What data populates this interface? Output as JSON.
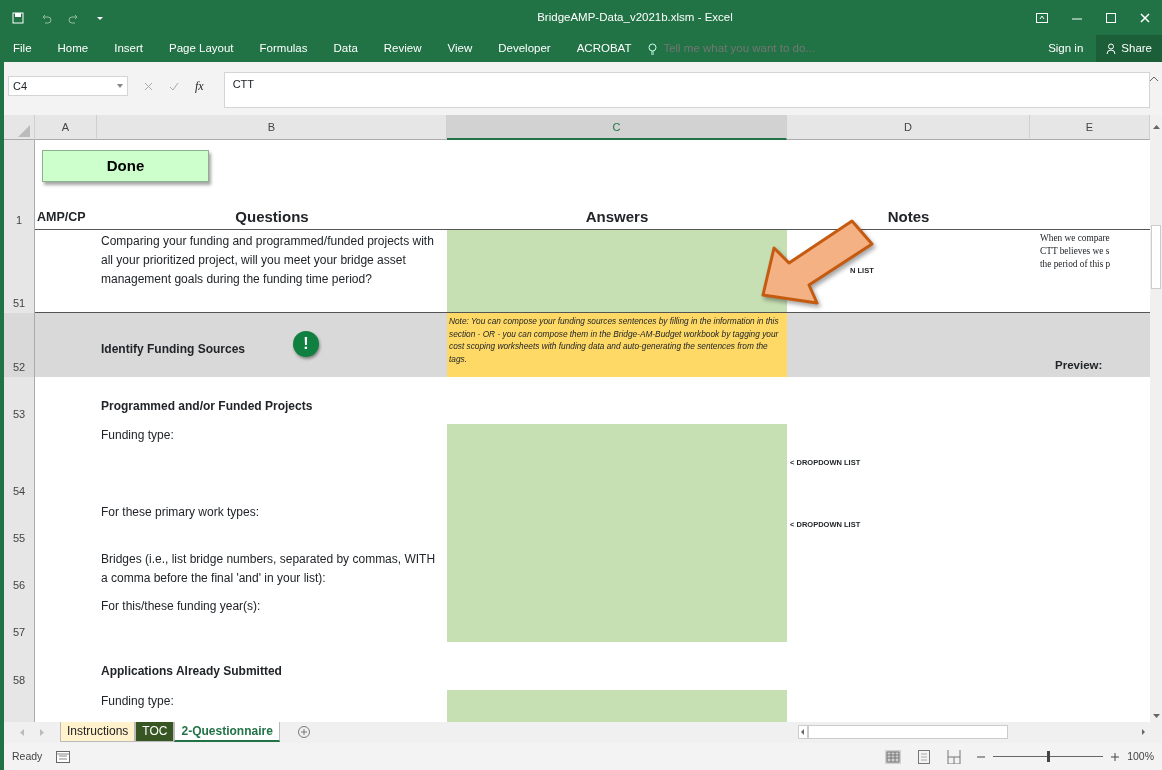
{
  "window": {
    "title": "BridgeAMP-Data_v2021b.xlsm - Excel"
  },
  "ribbon_tabs": [
    {
      "label": "File",
      "selected": false
    },
    {
      "label": "Home",
      "selected": false
    },
    {
      "label": "Insert",
      "selected": false
    },
    {
      "label": "Page Layout",
      "selected": false
    },
    {
      "label": "Formulas",
      "selected": false
    },
    {
      "label": "Data",
      "selected": false
    },
    {
      "label": "Review",
      "selected": false
    },
    {
      "label": "View",
      "selected": false
    },
    {
      "label": "Developer",
      "selected": false
    },
    {
      "label": "ACROBAT",
      "selected": false
    }
  ],
  "tell_me": {
    "placeholder": "Tell me what you want to do..."
  },
  "sign_in": "Sign in",
  "share": "Share",
  "formula_bar": {
    "name_box": "C4",
    "fx": "fx",
    "value": "CTT"
  },
  "column_headers": [
    {
      "label": "A",
      "selected": false
    },
    {
      "label": "B",
      "selected": false
    },
    {
      "label": "C",
      "selected": true
    },
    {
      "label": "D",
      "selected": false
    },
    {
      "label": "E",
      "selected": false
    }
  ],
  "done_button": "Done",
  "header_row": {
    "number": "1",
    "cells": [
      "AMP/CP",
      "Questions",
      "Answers",
      "Notes"
    ]
  },
  "rows": [
    {
      "number": "51",
      "kind": "question",
      "text": "Comparing your funding and programmed/funded projects with all your prioritized project, will you meet your bridge asset management goals during the funding time period?",
      "answer": true,
      "note": "N LIST",
      "side_lines": [
        "When we compare",
        "CTT believes we s",
        "the period of this p"
      ]
    },
    {
      "number": "52",
      "kind": "banner",
      "text": "Identify Funding Sources",
      "alert": "!",
      "answer_note": "Note: You can compose your funding sources sentences by filling in the information in this section - OR - you can compose them in the Bridge-AM-Budget workbook by tagging your cost scoping worksheets with funding data and auto-generating the sentences from the tags.",
      "side_label": "Preview:"
    },
    {
      "number": "53",
      "kind": "heading",
      "text": "Programmed and/or Funded Projects"
    },
    {
      "number": "54",
      "kind": "question",
      "text": "Funding type:",
      "answer": true,
      "note": "< DROPDOWN LIST"
    },
    {
      "number": "55",
      "kind": "question",
      "text": "For these primary work types:",
      "answer": true,
      "note": "< DROPDOWN LIST"
    },
    {
      "number": "56",
      "kind": "question",
      "text": "Bridges (i.e., list bridge numbers, separated by commas, WITH a comma before the final 'and' in your list):",
      "answer": true
    },
    {
      "number": "57",
      "kind": "question",
      "text": "For this/these funding year(s):",
      "answer": true
    },
    {
      "number": "58",
      "kind": "heading",
      "text": "Applications Already Submitted"
    },
    {
      "kind": "question",
      "text": "Funding type:",
      "answer": true
    }
  ],
  "sheet_tabs": [
    {
      "label": "Instructions",
      "selected": false,
      "color": "#fff2cc"
    },
    {
      "label": "TOC",
      "selected": false,
      "color": "#375623"
    },
    {
      "label": "2-Questionnaire",
      "selected": true,
      "color": "#ffffff"
    }
  ],
  "status_bar": {
    "text": "Ready",
    "zoom": {
      "level": 0.5,
      "reading": "100%"
    }
  }
}
